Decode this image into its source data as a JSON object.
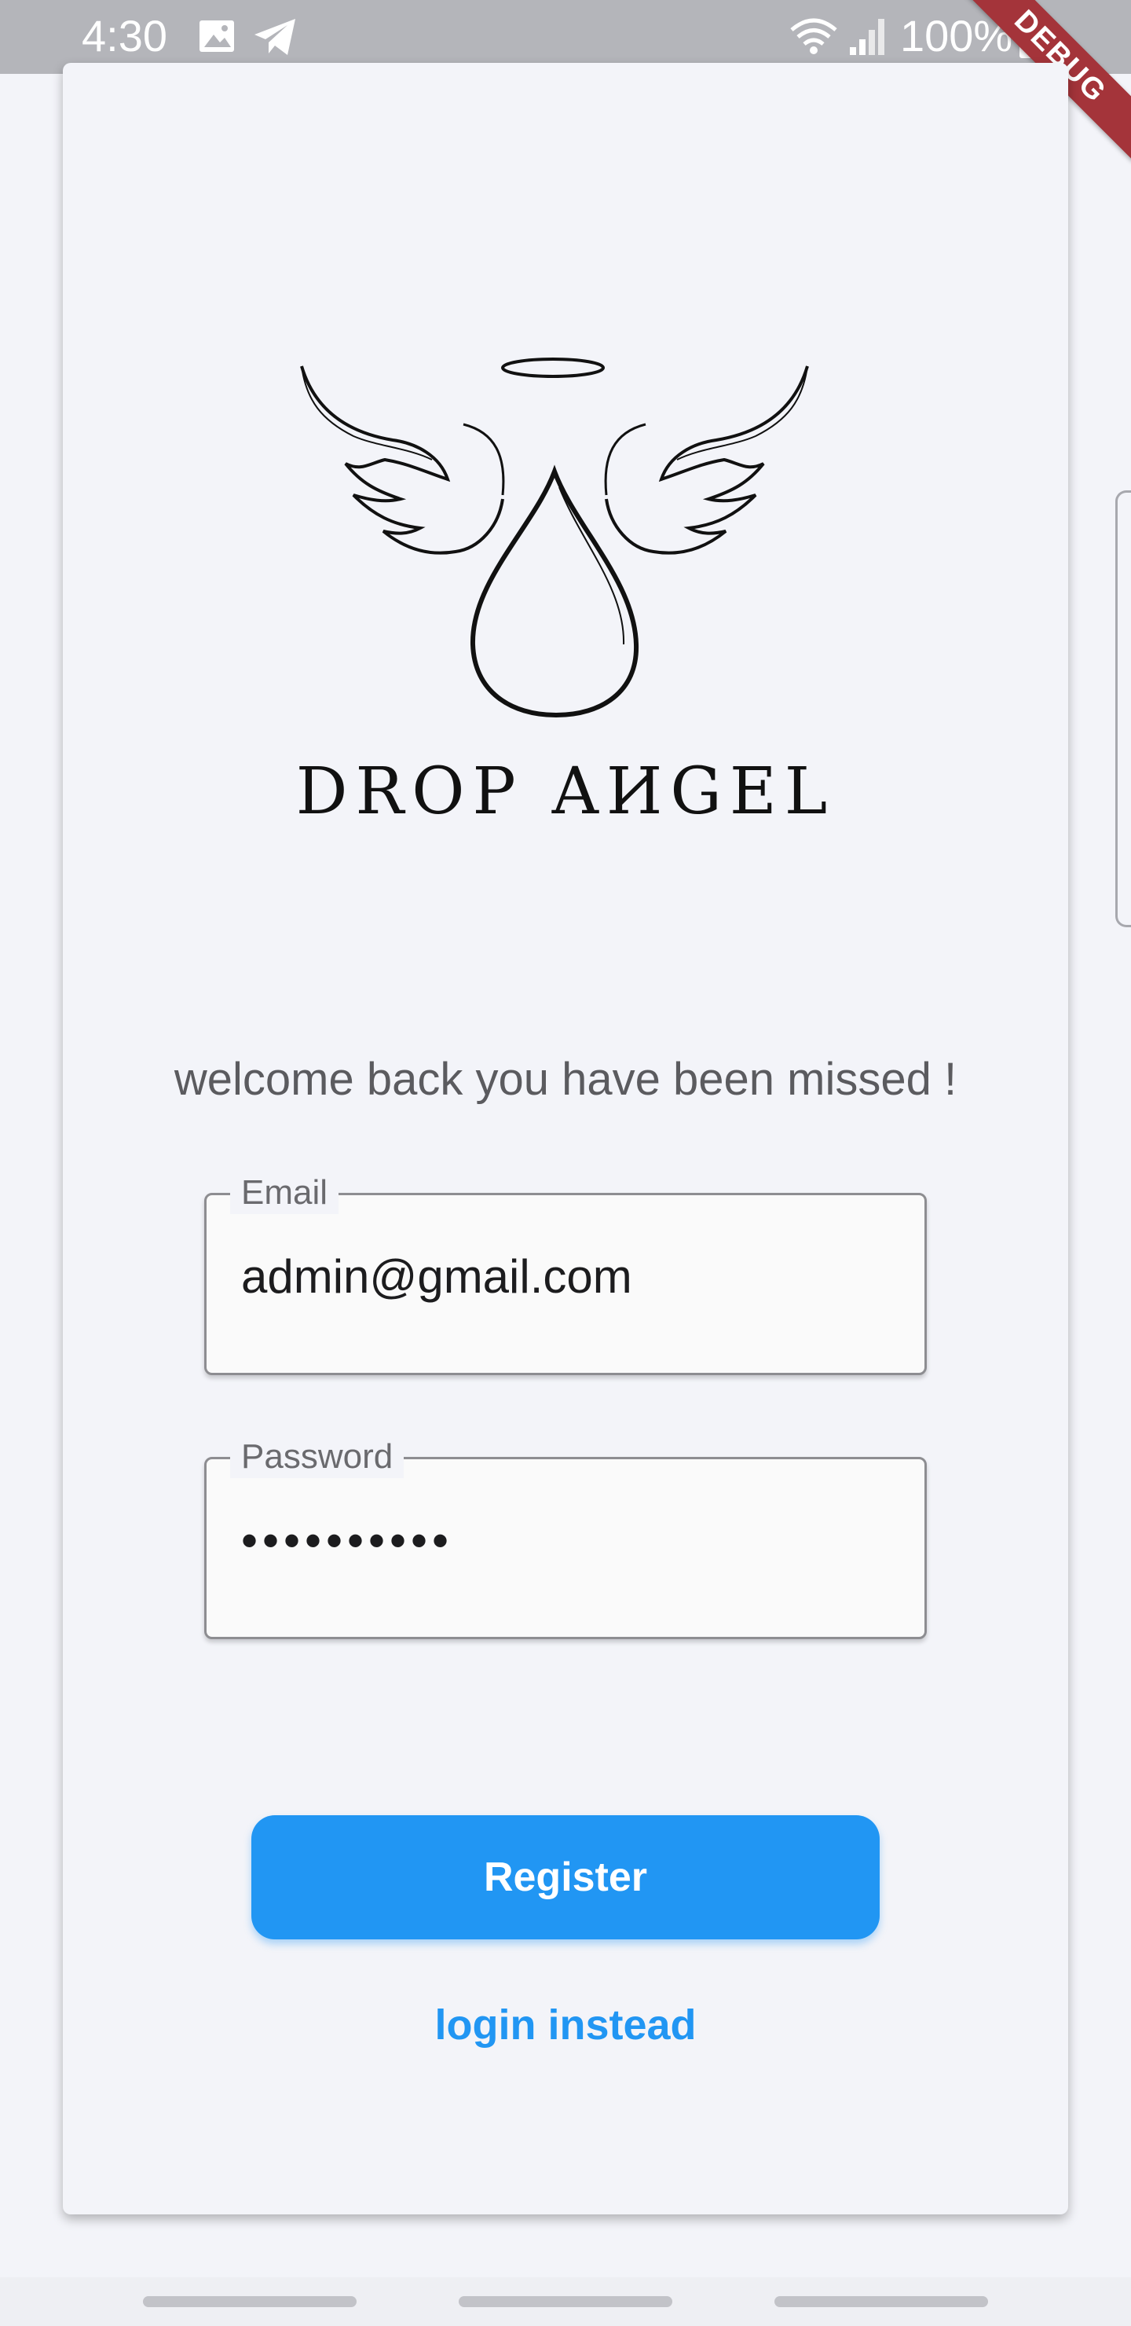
{
  "status_bar": {
    "time": "4:30",
    "battery_text": "100%",
    "icons": [
      "image-icon",
      "telegram-icon",
      "wifi-icon",
      "signal-icon",
      "battery-icon"
    ]
  },
  "debug_banner": "DEBUG",
  "logo": {
    "text": "DROP AИGEL"
  },
  "welcome_text": "welcome back you have been missed !",
  "email": {
    "label": "Email",
    "value": "admin@gmail.com"
  },
  "password": {
    "label": "Password",
    "value": "••••••••••"
  },
  "register_button": "Register",
  "login_link": "login instead",
  "colors": {
    "accent": "#2196f3",
    "background": "#f3f4f9",
    "status_bar": "#b4b5ba",
    "debug_ribbon": "#a4343a"
  }
}
